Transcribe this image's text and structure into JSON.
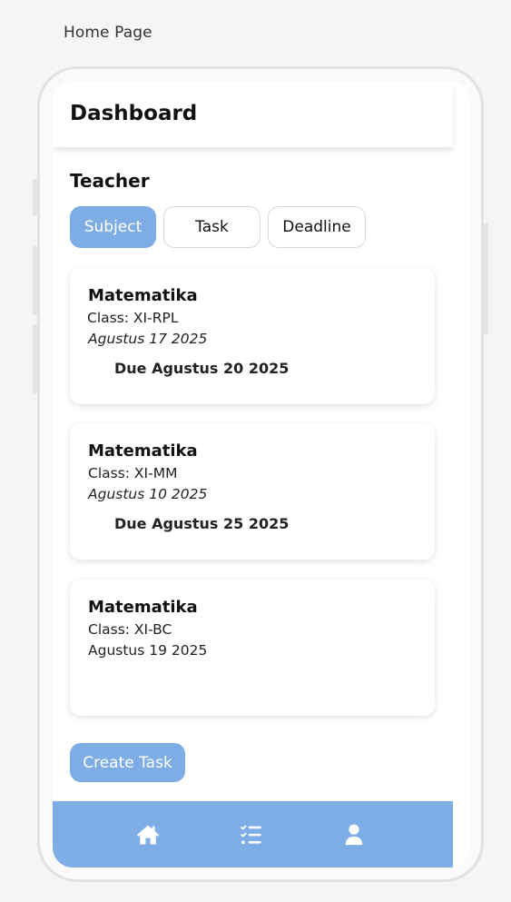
{
  "page_label": "Home Page",
  "header": {
    "title": "Dashboard"
  },
  "section": {
    "title": "Teacher"
  },
  "tabs": [
    {
      "label": "Subject",
      "active": true
    },
    {
      "label": "Task",
      "active": false
    },
    {
      "label": "Deadline",
      "active": false
    }
  ],
  "cards": [
    {
      "subject": "Matematika",
      "class": "Class: XI-RPL",
      "date": "Agustus 17 2025",
      "due": "Due Agustus 20 2025"
    },
    {
      "subject": "Matematika",
      "class": "Class: XI-MM",
      "date": "Agustus 10 2025",
      "due": "Due Agustus 25 2025"
    },
    {
      "subject": "Matematika",
      "class": "Class: XI-BC",
      "date": "Agustus 19 2025",
      "due": ""
    }
  ],
  "create_button": {
    "label": "Create Task"
  },
  "bottom_nav": [
    {
      "icon": "home-icon"
    },
    {
      "icon": "task-list-icon"
    },
    {
      "icon": "user-icon"
    }
  ],
  "colors": {
    "accent": "#7dade4",
    "background": "#f5f5f5",
    "card": "#ffffff"
  }
}
